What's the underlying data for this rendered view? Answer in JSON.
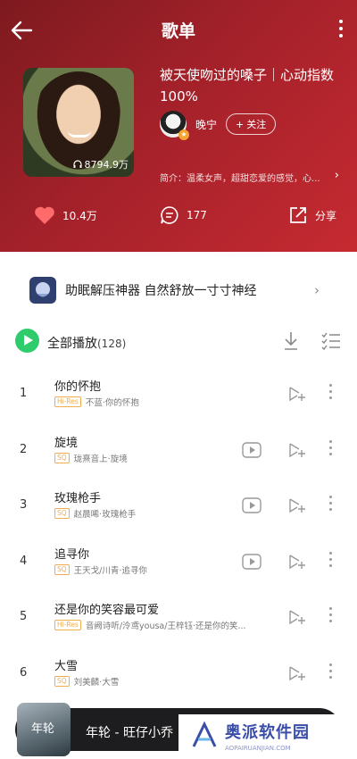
{
  "page": {
    "title": "歌单"
  },
  "playlist": {
    "name": "被天使吻过的嗓子｜心动指数100%",
    "play_count": "8794.9万",
    "creator": {
      "name": "晚宁",
      "follow_label": "关注"
    },
    "description": "简介：温柔女声，超甜恋爱的感觉，心..."
  },
  "actions": {
    "like_count": "10.4万",
    "comment_count": "177",
    "share_label": "分享"
  },
  "banner": {
    "text": "助眠解压神器 自然舒放一寸寸神经"
  },
  "play_all": {
    "label": "全部播放",
    "count": "(128)"
  },
  "songs": [
    {
      "no": "1",
      "title": "你的怀抱",
      "tag": "Hi-Res",
      "meta": "不蓝·你的怀抱",
      "mv": false
    },
    {
      "no": "2",
      "title": "旋境",
      "tag": "SQ",
      "meta": "珑熹音上·旋境",
      "mv": true
    },
    {
      "no": "3",
      "title": "玫瑰枪手",
      "tag": "SQ",
      "meta": "赵晨唏·玫瑰枪手",
      "mv": true
    },
    {
      "no": "4",
      "title": "追寻你",
      "tag": "SQ",
      "meta": "王天戈/川青·追寻你",
      "mv": true
    },
    {
      "no": "5",
      "title": "还是你的笑容最可爱",
      "tag": "Hi-Res",
      "meta": "音阙诗听/泠鸢yousa/王梓钰·还是你的笑...",
      "mv": false
    },
    {
      "no": "6",
      "title": "大雪",
      "tag": "SQ",
      "meta": "刘美麟·大雪",
      "mv": false
    }
  ],
  "player": {
    "now_playing": "年轮 - 旺仔小乔",
    "cover_text": "年轮"
  },
  "watermark": {
    "text": "奥派软件园",
    "sub": "AOPAIRUANJIAN.COM"
  },
  "colors": {
    "header": "#a4212a",
    "accent_green": "#2ecc6a",
    "tag": "#f0ad4e"
  }
}
